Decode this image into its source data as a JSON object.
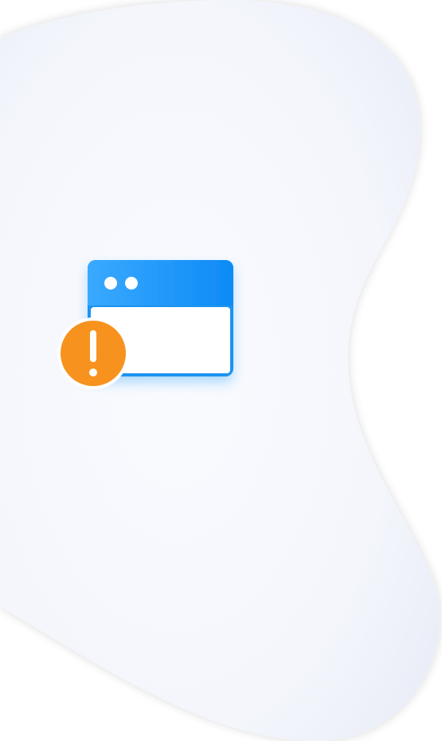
{
  "background": {
    "page_color": "#ffffff",
    "blob_color_center": "#f7f9fe",
    "blob_color_edge": "#e6eaf5"
  },
  "illustration": {
    "window_icon_name": "browser-window-icon",
    "warning_icon_name": "exclamation-warning-icon",
    "window_header_gradient": [
      "#3aa9ff",
      "#0d8bf5"
    ],
    "window_body_color": "#ffffff",
    "window_border_color": "#1a93f0",
    "warning_color": "#f7921e",
    "warning_ring_color": "#ffffff"
  }
}
